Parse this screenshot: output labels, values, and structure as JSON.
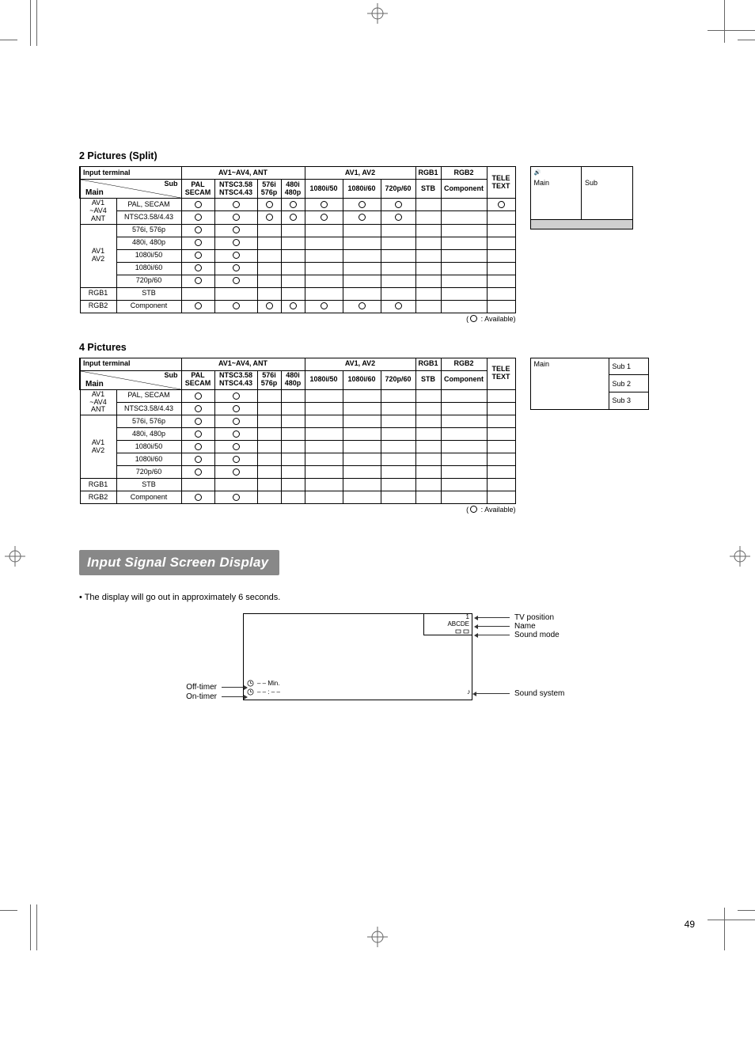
{
  "sections": {
    "split_title": "2 Pictures (Split)",
    "four_title": "4 Pictures",
    "banner": "Input Signal Screen Display",
    "note": "• The display will go out in approximately 6 seconds.",
    "legend_prefix": "(",
    "legend_suffix": " : Available)"
  },
  "headers": {
    "input_terminal": "Input terminal",
    "av14ant": "AV1~AV4, ANT",
    "av12": "AV1, AV2",
    "rgb1": "RGB1",
    "rgb2": "RGB2",
    "sub": "Sub",
    "main": "Main",
    "pal_secam": "PAL SECAM",
    "ntsc358_443": "NTSC3.58 NTSC4.43",
    "s576i_p": "576i 576p",
    "s480i_p": "480i 480p",
    "s1080i50": "1080i/50",
    "s1080i60": "1080i/60",
    "s720p60": "720p/60",
    "stb": "STB",
    "component": "Component",
    "teletext": "TELE TEXT"
  },
  "rowgroups": {
    "g1": "AV1\n~AV4\nANT",
    "g2": "AV1\nAV2",
    "g3": "RGB1",
    "g4": "RGB2"
  },
  "rows": {
    "pal_secam": "PAL, SECAM",
    "ntsc": "NTSC3.58/4.43",
    "r576": "576i, 576p",
    "r480": "480i, 480p",
    "r1080_50": "1080i/50",
    "r1080_60": "1080i/60",
    "r720": "720p/60",
    "stb": "STB",
    "component": "Component"
  },
  "split_diagram": {
    "main": "Main",
    "sub": "Sub"
  },
  "four_diagram": {
    "main": "Main",
    "sub1": "Sub 1",
    "sub2": "Sub 2",
    "sub3": "Sub 3"
  },
  "osd": {
    "pos_num": "1",
    "name": "ABCDE",
    "off_timer": "Off-timer",
    "on_timer": "On-timer",
    "off_val": "– – Min.",
    "on_val": "– – : – –",
    "call_tv_position": "TV position",
    "call_name": "Name",
    "call_sound_mode": "Sound mode",
    "call_sound_system": "Sound system",
    "note_symbol": "♪"
  },
  "page_number": "49"
}
